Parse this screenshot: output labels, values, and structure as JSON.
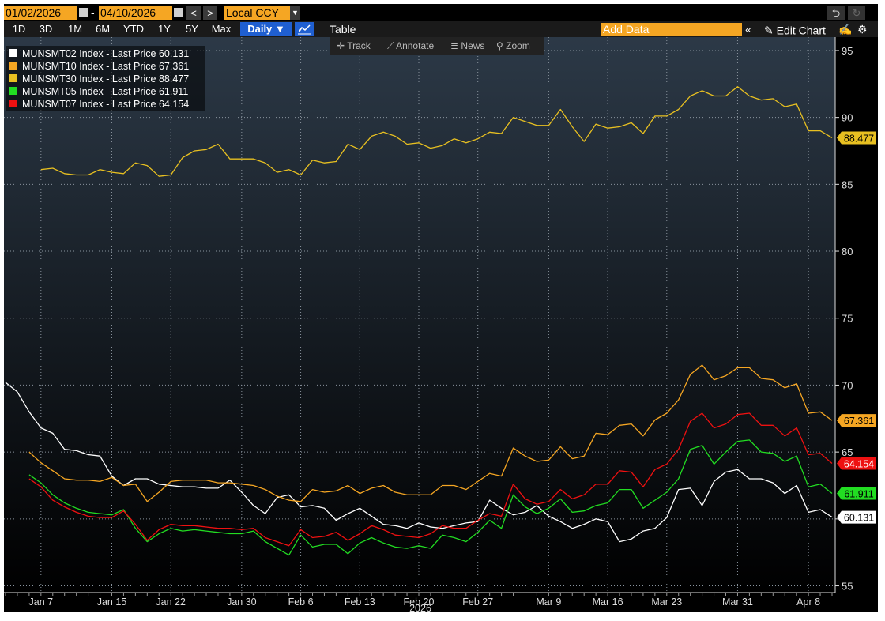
{
  "toolbar": {
    "start_date": "01/02/2026",
    "date_separator": "-",
    "end_date": "04/10/2026",
    "prev_label": "<",
    "next_label": ">",
    "currency": "Local CCY",
    "undo_icon": "undo-icon",
    "redo_icon": "redo-icon"
  },
  "periods": [
    "1D",
    "3D",
    "1M",
    "6M",
    "YTD",
    "1Y",
    "5Y",
    "Max"
  ],
  "frequency": "Daily ▼",
  "table_label": "Table",
  "add_data_placeholder": "Add Data",
  "collapse_label": "«",
  "edit_chart_label": "Edit Chart",
  "tools": {
    "track": "Track",
    "annotate": "Annotate",
    "news": "News",
    "zoom": "Zoom"
  },
  "colors": {
    "accent_orange": "#f5a623",
    "active_blue": "#1f5fd1",
    "plot_bg_top": "#2c3947",
    "plot_bg_bottom": "#000000"
  },
  "chart_data": {
    "type": "line",
    "x": [
      "2026-01-02",
      "2026-01-05",
      "2026-01-06",
      "2026-01-07",
      "2026-01-08",
      "2026-01-09",
      "2026-01-12",
      "2026-01-13",
      "2026-01-14",
      "2026-01-15",
      "2026-01-16",
      "2026-01-19",
      "2026-01-20",
      "2026-01-21",
      "2026-01-22",
      "2026-01-23",
      "2026-01-26",
      "2026-01-27",
      "2026-01-28",
      "2026-01-29",
      "2026-01-30",
      "2026-02-02",
      "2026-02-03",
      "2026-02-04",
      "2026-02-05",
      "2026-02-06",
      "2026-02-09",
      "2026-02-10",
      "2026-02-11",
      "2026-02-12",
      "2026-02-13",
      "2026-02-16",
      "2026-02-17",
      "2026-02-18",
      "2026-02-19",
      "2026-02-20",
      "2026-02-23",
      "2026-02-24",
      "2026-02-25",
      "2026-02-26",
      "2026-02-27",
      "2026-03-02",
      "2026-03-03",
      "2026-03-04",
      "2026-03-05",
      "2026-03-06",
      "2026-03-09",
      "2026-03-10",
      "2026-03-11",
      "2026-03-12",
      "2026-03-13",
      "2026-03-16",
      "2026-03-17",
      "2026-03-18",
      "2026-03-19",
      "2026-03-20",
      "2026-03-23",
      "2026-03-24",
      "2026-03-25",
      "2026-03-26",
      "2026-03-27",
      "2026-03-30",
      "2026-03-31",
      "2026-04-01",
      "2026-04-02",
      "2026-04-03",
      "2026-04-06",
      "2026-04-07",
      "2026-04-08",
      "2026-04-09",
      "2026-04-10"
    ],
    "x_ticks": [
      {
        "date": "2026-01-07",
        "label": "Jan 7"
      },
      {
        "date": "2026-01-15",
        "label": "Jan 15"
      },
      {
        "date": "2026-01-22",
        "label": "Jan 22"
      },
      {
        "date": "2026-01-30",
        "label": "Jan 30"
      },
      {
        "date": "2026-02-06",
        "label": "Feb 6"
      },
      {
        "date": "2026-02-13",
        "label": "Feb 13"
      },
      {
        "date": "2026-02-20",
        "label": "Feb 20"
      },
      {
        "date": "2026-02-27",
        "label": "Feb 27"
      },
      {
        "date": "2026-03-09",
        "label": "Mar 9"
      },
      {
        "date": "2026-03-16",
        "label": "Mar 16"
      },
      {
        "date": "2026-03-23",
        "label": "Mar 23"
      },
      {
        "date": "2026-03-31",
        "label": "Mar 31"
      },
      {
        "date": "2026-04-08",
        "label": "Apr 8"
      }
    ],
    "year_label": "2026",
    "ylim": [
      54.5,
      96
    ],
    "yticks": [
      55,
      60,
      65,
      70,
      75,
      80,
      85,
      90,
      95
    ],
    "grid": true,
    "y_axis_side": "right",
    "legend_position": "top-left",
    "series": [
      {
        "name": "MUNSMT02 Index - Last Price 60.131",
        "color": "#ffffff",
        "last_label": "60.131",
        "values": [
          70.2,
          69.5,
          68.0,
          66.8,
          66.4,
          65.2,
          65.1,
          64.8,
          64.7,
          63.2,
          62.5,
          63.0,
          63.0,
          62.6,
          62.5,
          62.4,
          62.4,
          62.3,
          62.3,
          62.9,
          62.0,
          61.0,
          60.4,
          61.6,
          61.8,
          60.9,
          61.0,
          60.8,
          59.9,
          60.4,
          60.8,
          60.2,
          59.6,
          59.5,
          59.3,
          59.7,
          59.4,
          59.3,
          59.5,
          59.7,
          59.8,
          61.4,
          60.8,
          60.3,
          60.5,
          61.0,
          60.2,
          59.8,
          59.3,
          59.6,
          60.0,
          59.8,
          58.3,
          58.5,
          59.1,
          59.3,
          60.1,
          62.2,
          62.3,
          61.0,
          62.8,
          63.5,
          63.7,
          63.0,
          63.0,
          62.7,
          61.9,
          62.5,
          60.5,
          60.7,
          60.131
        ]
      },
      {
        "name": "MUNSMT10 Index - Last Price 67.361",
        "color": "#f5a623",
        "last_label": "67.361",
        "values": [
          65.0,
          64.2,
          63.6,
          63.0,
          62.9,
          62.9,
          62.8,
          63.1,
          62.5,
          62.6,
          61.3,
          62.0,
          62.8,
          62.9,
          62.9,
          62.9,
          62.7,
          62.7,
          62.6,
          62.5,
          62.2,
          61.7,
          61.4,
          61.3,
          62.2,
          62.0,
          62.1,
          62.5,
          61.9,
          62.3,
          62.5,
          62.0,
          61.8,
          61.8,
          61.8,
          62.5,
          62.5,
          62.2,
          62.8,
          63.4,
          63.2,
          65.3,
          64.7,
          64.3,
          64.4,
          65.4,
          64.5,
          64.7,
          66.4,
          66.3,
          67.0,
          67.1,
          66.2,
          67.4,
          67.9,
          68.9,
          70.8,
          71.5,
          70.4,
          70.7,
          71.3,
          71.3,
          70.5,
          70.4,
          69.8,
          70.1,
          67.9,
          68.0,
          67.361
        ]
      },
      {
        "name": "MUNSMT30 Index - Last Price 88.477",
        "color": "#e8c021",
        "last_label": "88.477",
        "values": [
          86.1,
          86.2,
          85.8,
          85.7,
          85.7,
          86.1,
          85.9,
          85.8,
          86.6,
          86.4,
          85.6,
          85.7,
          87.0,
          87.5,
          87.6,
          88.0,
          86.9,
          86.9,
          86.9,
          86.6,
          85.9,
          86.1,
          85.7,
          86.8,
          86.6,
          86.7,
          88.0,
          87.6,
          88.6,
          88.9,
          88.6,
          88.0,
          88.1,
          87.7,
          87.9,
          88.4,
          88.1,
          88.4,
          88.9,
          88.8,
          90.0,
          89.7,
          89.4,
          89.4,
          90.6,
          89.3,
          88.2,
          89.5,
          89.2,
          89.3,
          89.6,
          88.8,
          90.1,
          90.1,
          90.6,
          91.6,
          92.0,
          91.6,
          91.6,
          92.3,
          91.6,
          91.3,
          91.4,
          90.8,
          91.0,
          89.0,
          89.0,
          88.477
        ]
      },
      {
        "name": "MUNSMT05 Index - Last Price 61.911",
        "color": "#22dd22",
        "last_label": "61.911",
        "values": [
          63.3,
          62.7,
          61.8,
          61.2,
          60.8,
          60.5,
          60.4,
          60.3,
          60.7,
          59.3,
          58.3,
          58.9,
          59.3,
          59.1,
          59.2,
          59.1,
          59.0,
          58.9,
          58.9,
          59.1,
          58.3,
          57.8,
          57.3,
          58.8,
          57.9,
          58.1,
          58.1,
          57.4,
          58.2,
          58.6,
          58.2,
          57.9,
          57.8,
          58.0,
          57.8,
          58.8,
          58.6,
          58.3,
          59.0,
          59.9,
          59.3,
          61.8,
          60.9,
          60.4,
          60.8,
          61.5,
          60.5,
          60.6,
          61.0,
          61.2,
          62.2,
          62.2,
          60.8,
          61.4,
          62.0,
          63.0,
          65.2,
          65.5,
          64.1,
          65.0,
          65.8,
          65.9,
          65.0,
          64.9,
          64.3,
          64.7,
          62.4,
          62.6,
          61.911
        ]
      },
      {
        "name": "MUNSMT07 Index - Last Price 64.154",
        "color": "#ee1111",
        "last_label": "64.154",
        "values": [
          63.0,
          62.4,
          61.4,
          60.9,
          60.5,
          60.2,
          60.1,
          60.1,
          60.6,
          59.6,
          58.4,
          59.2,
          59.6,
          59.5,
          59.5,
          59.4,
          59.3,
          59.3,
          59.2,
          59.3,
          58.6,
          58.3,
          58.0,
          59.2,
          58.6,
          58.7,
          59.0,
          58.4,
          58.9,
          59.5,
          59.2,
          58.8,
          58.7,
          58.6,
          58.9,
          59.5,
          59.3,
          59.3,
          59.9,
          60.4,
          60.2,
          62.6,
          61.5,
          61.1,
          61.3,
          62.2,
          61.5,
          61.8,
          62.6,
          62.6,
          63.6,
          63.5,
          62.4,
          63.7,
          64.1,
          65.2,
          67.3,
          67.9,
          66.8,
          67.1,
          67.8,
          67.9,
          67.0,
          67.0,
          66.2,
          66.8,
          64.8,
          64.9,
          64.154
        ]
      }
    ]
  }
}
